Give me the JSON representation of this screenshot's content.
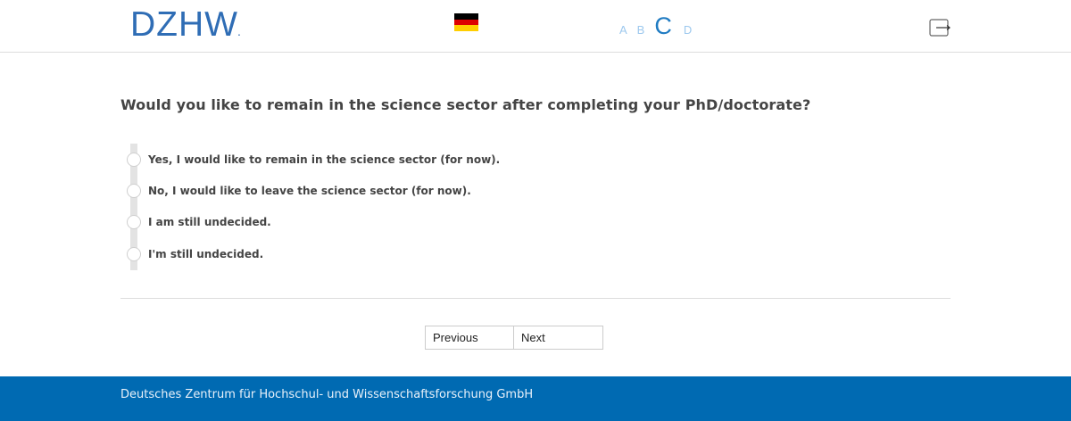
{
  "header": {
    "logo_text": "DZHW",
    "logo_dot": ".",
    "language_flag_icon": "german-flag-icon",
    "steps": [
      {
        "label": "A",
        "active": false
      },
      {
        "label": "B",
        "active": false
      },
      {
        "label": "C",
        "active": true
      },
      {
        "label": "D",
        "active": false
      }
    ],
    "logout_icon": "logout-icon"
  },
  "question": {
    "text": "Would you like to remain in the science sector after completing your PhD/doctorate?",
    "options": [
      {
        "label": "Yes, I would like to remain in the science sector (for now).",
        "selected": false
      },
      {
        "label": "No, I would like to leave the science sector (for now).",
        "selected": false
      },
      {
        "label": "I am still undecided.",
        "selected": false
      },
      {
        "label": "I'm still undecided.",
        "selected": false
      }
    ]
  },
  "navigation": {
    "previous_label": "Previous",
    "next_label": "Next"
  },
  "footer": {
    "text": "Deutsches Zentrum für Hochschul- und Wissenschaftsforschung GmbH"
  },
  "colors": {
    "brand_blue": "#006ab2",
    "logo_blue": "#2f6db5",
    "step_inactive": "#9cc8ee",
    "step_active": "#1f7bc2"
  }
}
